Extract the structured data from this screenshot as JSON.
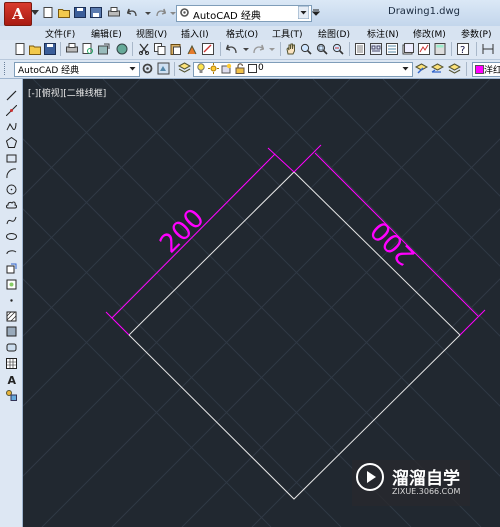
{
  "app": {
    "logo_letter": "A",
    "window_title": "Drawing1.dwg",
    "workspace": "AutoCAD 经典"
  },
  "menu": [
    {
      "label": "文件(F)"
    },
    {
      "label": "编辑(E)"
    },
    {
      "label": "视图(V)"
    },
    {
      "label": "插入(I)"
    },
    {
      "label": "格式(O)"
    },
    {
      "label": "工具(T)"
    },
    {
      "label": "绘图(D)"
    },
    {
      "label": "标注(N)"
    },
    {
      "label": "修改(M)"
    },
    {
      "label": "参数(P)"
    }
  ],
  "toolbar2": {
    "style_value": "AutoCAD 经典",
    "layer_value": "0",
    "color_value": "洋红"
  },
  "viewport": {
    "label": "[-][俯视][二维线框]"
  },
  "drawing": {
    "dimension_left": "200",
    "dimension_right": "200",
    "line_color": "#e6e6e6",
    "dimension_color": "#ff00ff",
    "background_color": "#212830"
  },
  "watermark": {
    "title": "溜溜自学",
    "url": "ZIXUE.3066.COM"
  }
}
